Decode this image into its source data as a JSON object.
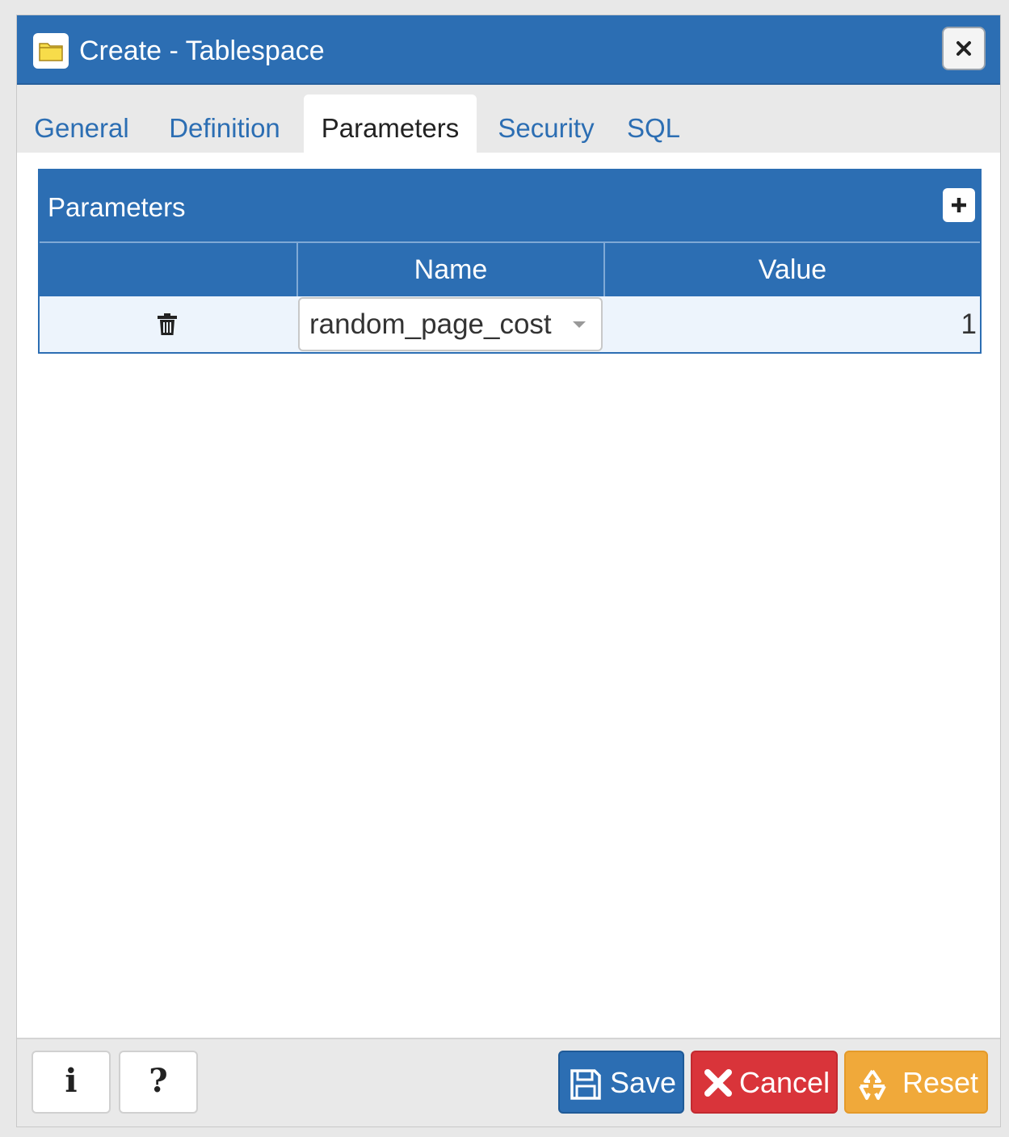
{
  "dialog": {
    "title": "Create - Tablespace",
    "title_icon": "tablespace-folder-icon",
    "close_icon": "close-icon"
  },
  "tabs": [
    {
      "label": "General",
      "active": false
    },
    {
      "label": "Definition",
      "active": false
    },
    {
      "label": "Parameters",
      "active": true
    },
    {
      "label": "Security",
      "active": false
    },
    {
      "label": "SQL",
      "active": false
    }
  ],
  "parameters": {
    "title": "Parameters",
    "add_icon": "plus-icon",
    "columns": {
      "action": "",
      "name": "Name",
      "value": "Value"
    },
    "rows": [
      {
        "delete_icon": "trash-icon",
        "name": "random_page_cost",
        "value": "1"
      }
    ]
  },
  "footer": {
    "info_glyph": "i",
    "help_glyph": "?",
    "save_label": "Save",
    "cancel_label": "Cancel",
    "reset_label": "Reset"
  },
  "colors": {
    "primary": "#2c6eb3",
    "danger": "#d9343a",
    "warning": "#f0a93a",
    "row_highlight": "#edf4fc"
  }
}
